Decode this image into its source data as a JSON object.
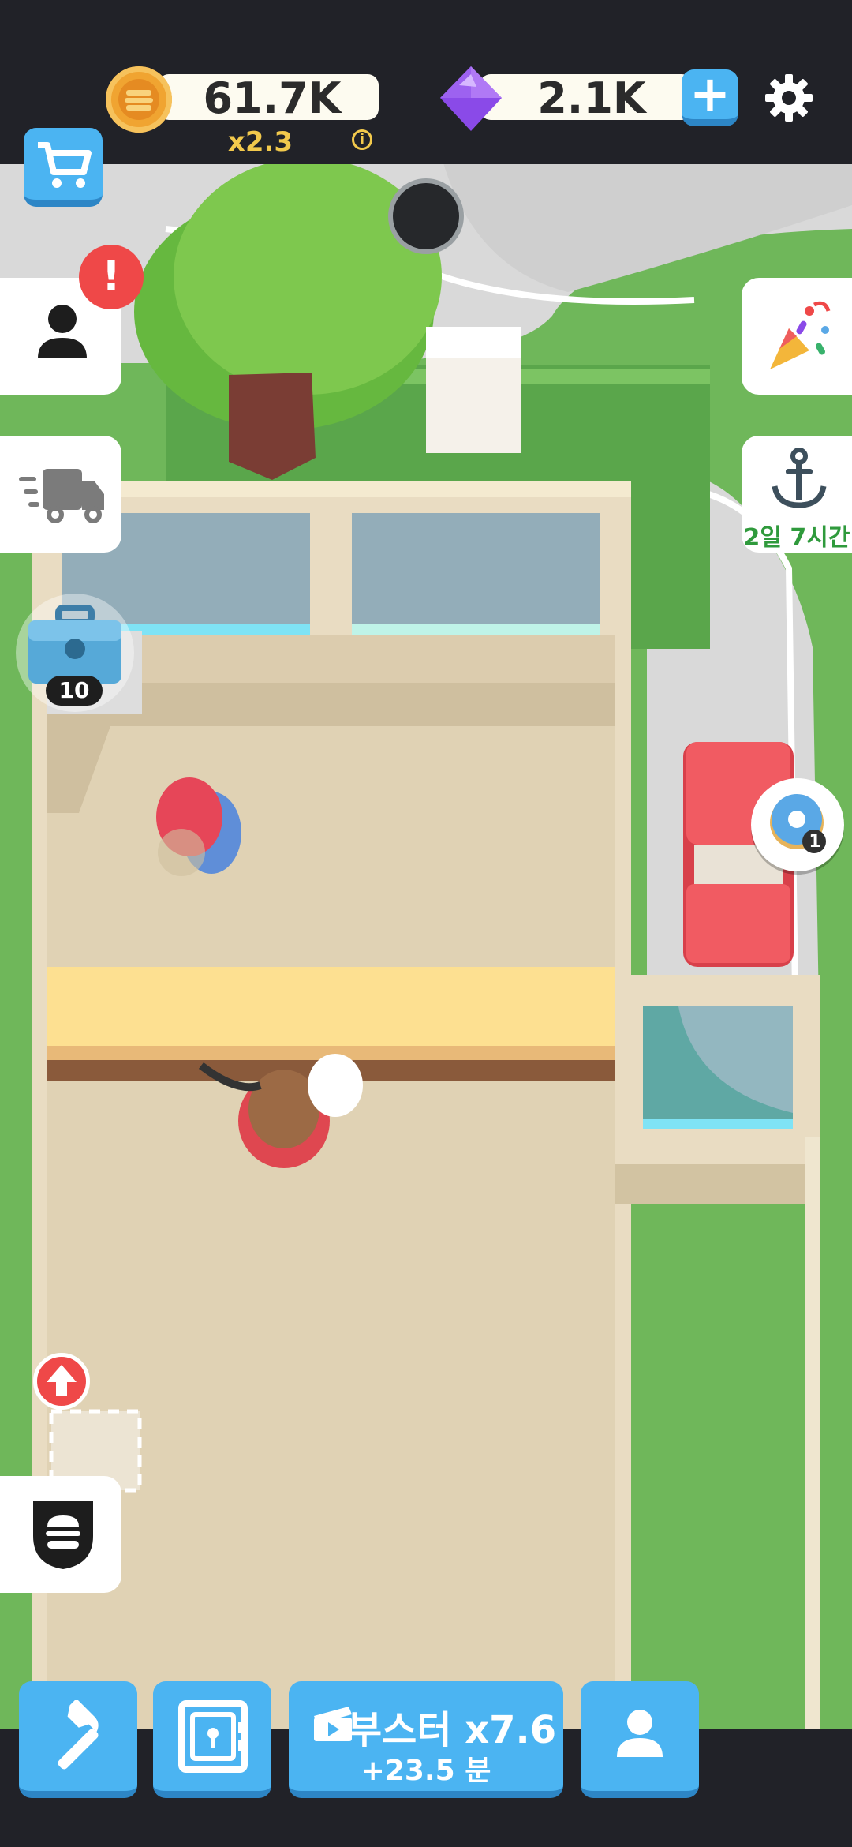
{
  "hud": {
    "coins": "61.7K",
    "coin_multiplier": "x2.3",
    "gems": "2.1K",
    "info_symbol": "i",
    "add_symbol": "+",
    "alert_symbol": "!"
  },
  "side_buttons": {
    "event_timer": "2일 7시간",
    "chest_count": "10"
  },
  "bottom_nav": {
    "booster_label": "부스터 x7.6",
    "booster_time": "+23.5 분"
  },
  "world": {
    "order_bubble_count": "1"
  },
  "colors": {
    "hud_background": "#212228",
    "button_blue": "#4bb4f2",
    "coin_gold": "#f0a431",
    "gem_purple": "#8a4ae8",
    "alert_red": "#ef4848",
    "floor_beige": "#e1d3b5",
    "grass_green": "#6fb75a",
    "timer_green": "#2f9a3c"
  }
}
